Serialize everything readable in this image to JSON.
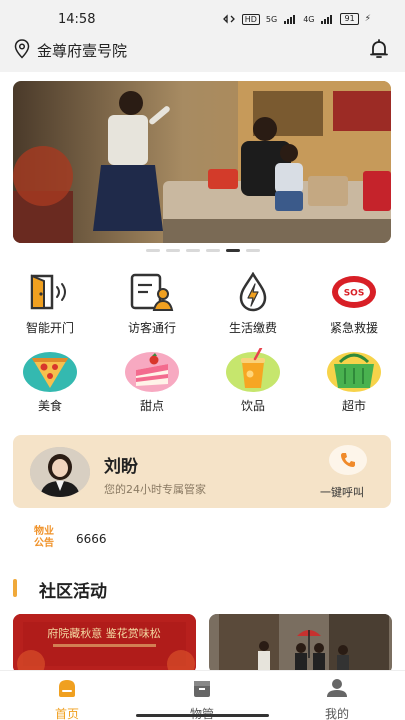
{
  "status_bar": {
    "time": "14:58",
    "indicators": [
      "HD",
      "5G",
      "4G"
    ],
    "battery": "91",
    "icons": [
      "bluetooth-icon",
      "signal-icon",
      "battery-icon",
      "charging-icon"
    ]
  },
  "header": {
    "location_icon": "location-pin-icon",
    "location": "金尊府壹号院",
    "bell_icon": "bell-icon"
  },
  "banner": {
    "image": "family-living-room-photo",
    "page_count": 6,
    "active_page": 5
  },
  "services": [
    {
      "label": "智能开门",
      "icon": "door-open-icon"
    },
    {
      "label": "访客通行",
      "icon": "visitor-pass-icon"
    },
    {
      "label": "生活缴费",
      "icon": "utility-payment-icon"
    },
    {
      "label": "紧急救援",
      "icon": "sos-icon",
      "badge": "SOS"
    },
    {
      "label": "美食",
      "icon": "pizza-icon"
    },
    {
      "label": "甜点",
      "icon": "cake-icon"
    },
    {
      "label": "饮品",
      "icon": "drink-icon"
    },
    {
      "label": "超市",
      "icon": "basket-icon"
    }
  ],
  "butler": {
    "name": "刘盼",
    "subtitle": "您的24小时专属管家",
    "call_label": "一键呼叫",
    "call_icon": "phone-icon",
    "avatar_icon": "avatar"
  },
  "notice": {
    "badge_line1": "物业",
    "badge_line2": "公告",
    "text": "6666"
  },
  "section": {
    "title": "社区活动"
  },
  "activity_cards": [
    {
      "image": "mid-autumn-event-poster",
      "title": "府院藏秋意 鉴花赏味松"
    },
    {
      "image": "community-entrance-photo"
    }
  ],
  "tabbar": {
    "tabs": [
      {
        "label": "首页",
        "icon": "home-icon",
        "active": true
      },
      {
        "label": "物管",
        "icon": "property-box-icon",
        "active": false
      },
      {
        "label": "我的",
        "icon": "profile-icon",
        "active": false
      }
    ]
  },
  "colors": {
    "accent": "#f0a020",
    "butler_card": "#f5e3c8",
    "sos_red": "#d81f26"
  }
}
